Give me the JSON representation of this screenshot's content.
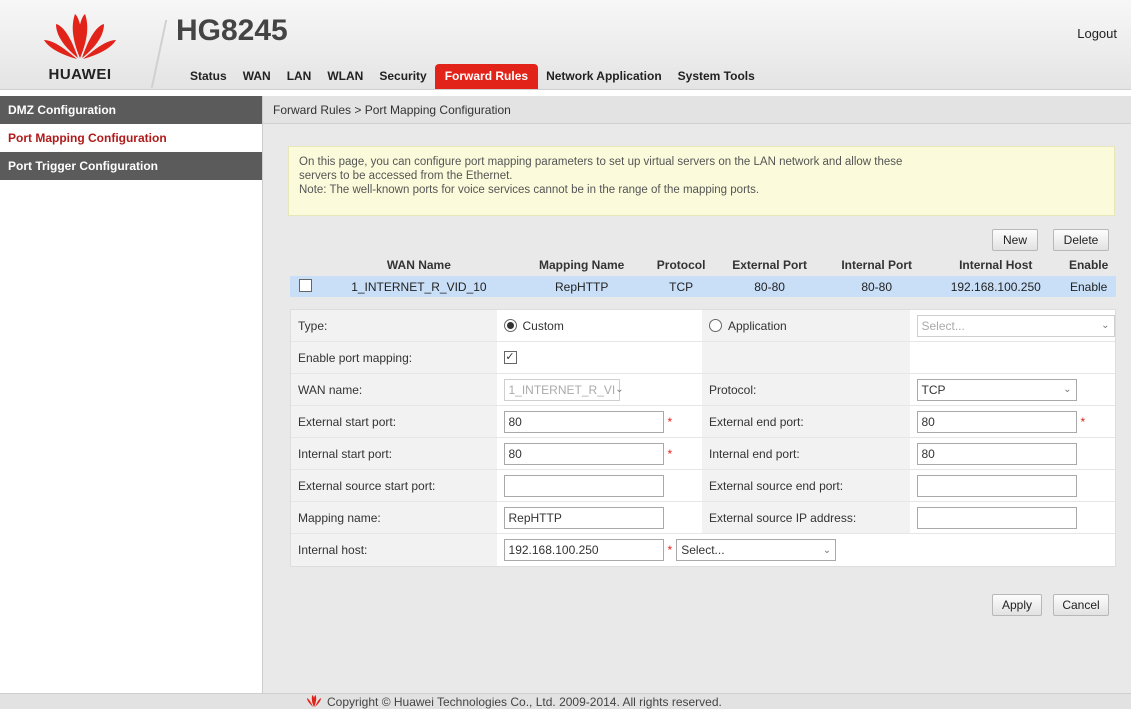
{
  "header": {
    "model": "HG8245",
    "logo_text": "HUAWEI",
    "logout": "Logout",
    "brand_color": "#e2231a",
    "nav": [
      "Status",
      "WAN",
      "LAN",
      "WLAN",
      "Security",
      "Forward Rules",
      "Network Application",
      "System Tools"
    ],
    "active_nav": "Forward Rules"
  },
  "sidebar": {
    "items": [
      {
        "label": "DMZ Configuration"
      },
      {
        "label": "Port Mapping Configuration"
      },
      {
        "label": "Port Trigger Configuration"
      }
    ],
    "active": "Port Mapping Configuration"
  },
  "breadcrumb": "Forward Rules > Port Mapping Configuration",
  "info": {
    "line1": "On this page, you can configure port mapping parameters to set up virtual servers on the LAN network and allow these",
    "line2": "servers to be accessed from the Ethernet.",
    "line3": "Note: The well-known ports for voice services cannot be in the range of the mapping ports."
  },
  "buttons": {
    "new": "New",
    "delete": "Delete",
    "apply": "Apply",
    "cancel": "Cancel"
  },
  "table": {
    "headers": [
      "WAN Name",
      "Mapping Name",
      "Protocol",
      "External Port",
      "Internal Port",
      "Internal Host",
      "Enable"
    ],
    "rows": [
      [
        "1_INTERNET_R_VID_10",
        "RepHTTP",
        "TCP",
        "80-80",
        "80-80",
        "192.168.100.250",
        "Enable"
      ]
    ]
  },
  "form": {
    "type_label": "Type:",
    "type_custom": "Custom",
    "type_application": "Application",
    "application_select": "Select...",
    "enable_label": "Enable port mapping:",
    "wan_label": "WAN name:",
    "wan_value": "1_INTERNET_R_VI",
    "protocol_label": "Protocol:",
    "protocol_value": "TCP",
    "ext_start_label": "External start port:",
    "ext_start_value": "80",
    "ext_end_label": "External end port:",
    "ext_end_value": "80",
    "int_start_label": "Internal start port:",
    "int_start_value": "80",
    "int_end_label": "Internal end port:",
    "int_end_value": "80",
    "src_start_label": "External source start port:",
    "src_start_value": "",
    "src_end_label": "External source end port:",
    "src_end_value": "",
    "mapping_label": "Mapping name:",
    "mapping_value": "RepHTTP",
    "src_ip_label": "External source IP address:",
    "src_ip_value": "",
    "host_label": "Internal host:",
    "host_value": "192.168.100.250",
    "host_select": "Select...",
    "required_mark": "*"
  },
  "footer": {
    "text": "Copyright © Huawei Technologies Co., Ltd. 2009-2014. All rights reserved."
  }
}
